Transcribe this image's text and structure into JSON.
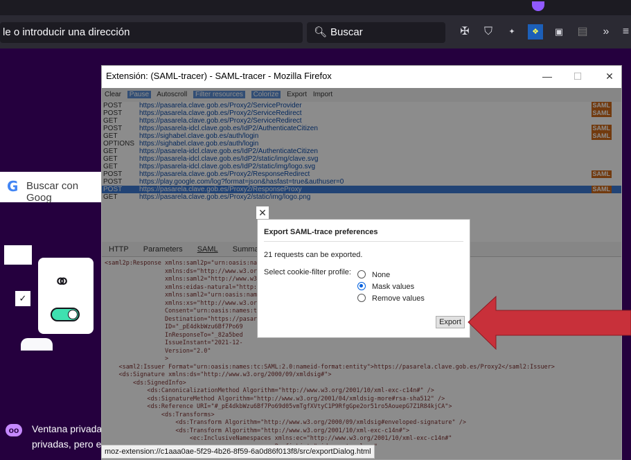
{
  "browser": {
    "urlbar_text": "le o introducir una dirección",
    "search_placeholder": "Buscar"
  },
  "private_page": {
    "google_search_text": "Buscar con Goog",
    "private_line1": "Ventana privada:",
    "private_line2": "privadas, pero es"
  },
  "window": {
    "title": "Extensión: (SAML-tracer) - SAML-tracer - Mozilla Firefox",
    "minimize": "—",
    "maximize": "☐",
    "close": "✕"
  },
  "tracer": {
    "toolbar": [
      "Clear",
      "Pause",
      "Autoscroll",
      "Filter resources",
      "Colorize",
      "Export",
      "Import"
    ],
    "requests": [
      {
        "method": "POST",
        "url": "https://pasarela.clave.gob.es/Proxy2/ServiceProvider",
        "badge": "SAML"
      },
      {
        "method": "POST",
        "url": "https://pasarela.clave.gob.es/Proxy2/ServiceRedirect",
        "badge": "SAML"
      },
      {
        "method": "GET",
        "url": "https://pasarela.clave.gob.es/Proxy2/ServiceRedirect",
        "badge": ""
      },
      {
        "method": "POST",
        "url": "https://pasarela-idcl.clave.gob.es/IdP2/AuthenticateCitizen",
        "badge": "SAML"
      },
      {
        "method": "GET",
        "url": "https://sighabel.clave.gob.es/auth/login",
        "badge": "SAML"
      },
      {
        "method": "OPTIONS",
        "url": "https://sighabel.clave.gob.es/auth/login",
        "badge": ""
      },
      {
        "method": "GET",
        "url": "https://pasarela-idcl.clave.gob.es/IdP2/AuthenticateCitizen",
        "badge": ""
      },
      {
        "method": "GET",
        "url": "https://pasarela-idcl.clave.gob.es/IdP2/static/img/clave.svg",
        "badge": ""
      },
      {
        "method": "GET",
        "url": "https://pasarela-idcl.clave.gob.es/IdP2/static/img/logo.svg",
        "badge": ""
      },
      {
        "method": "POST",
        "url": "https://pasarela.clave.gob.es/Proxy2/ResponseRedirect",
        "badge": "SAML"
      },
      {
        "method": "POST",
        "url": "https://play.google.com/log?format=json&hasfast=true&authuser=0",
        "badge": ""
      },
      {
        "method": "POST",
        "url": "https://pasarela.clave.gob.es/Proxy2/ResponseProxy",
        "badge": "SAML"
      },
      {
        "method": "GET",
        "url": "https://pasarela.clave.gob.es/Proxy2/static/img/logo.png",
        "badge": ""
      }
    ],
    "tabs": [
      "HTTP",
      "Parameters",
      "SAML",
      "Summary"
    ],
    "xml_lines": [
      "<saml2p:Response xmlns:saml2p=\"urn:oasis:names:tc:SAML:2.0:protocol\"",
      "                 xmlns:ds=\"http://www.w3.org/2000/09/xmldsig#\"",
      "                 xmlns:saml2=\"http://www.w3.org/2001/04/xmlenc#\"",
      "                 xmlns:eidas-natural=\"http://eidas.europa.eu/attributes/naturalperson\"",
      "                 xmlns:saml2=\"urn:oasis:names:tc:SAML:2.0:assertion\"",
      "                 xmlns:xs=\"http://www.w3.org/2001/XMLSchema\"",
      "                 Consent=\"urn:oasis:names:tc:SAML:2.0:consent:obtained\"",
      "                 Destination=\"https://pasarela.clave.gob.es/Proxy2/ResponseClave\"",
      "                 ID=\"_pE4dkbWzu6Bf7Po69",
      "                 InResponseTo=\"_82a5bed",
      "                 IssueInstant=\"2021-12-",
      "                 Version=\"2.0\"",
      "                 >",
      "    <saml2:Issuer Format=\"urn:oasis:names:tc:SAML:2.0:nameid-format:entity\">https://pasarela.clave.gob.es/Proxy2</saml2:Issuer>",
      "    <ds:Signature xmlns:ds=\"http://www.w3.org/2000/09/xmldsig#\">",
      "        <ds:SignedInfo>",
      "            <ds:CanonicalizationMethod Algorithm=\"http://www.w3.org/2001/10/xml-exc-c14n#\" />",
      "            <ds:SignatureMethod Algorithm=\"http://www.w3.org/2001/04/xmldsig-more#rsa-sha512\" />",
      "            <ds:Reference URI=\"#_pE4dkbWzu6Bf7Po69d05vmTgfXVtyC1P9RfgGpe2or51ro5AouepG7Z1R84kjCA\">",
      "                <ds:Transforms>",
      "                    <ds:Transform Algorithm=\"http://www.w3.org/2000/09/xmldsig#enveloped-signature\" />",
      "                    <ds:Transform Algorithm=\"http://www.w3.org/2001/10/xml-exc-c14n#\">",
      "                        <ec:InclusiveNamespaces xmlns:ec=\"http://www.w3.org/2001/10/xml-exc-c14n#\"",
      "                                                PrefixList=\"eidas-natural xs\""
    ]
  },
  "dialog": {
    "close": "✕",
    "title": "Export SAML-trace preferences",
    "count_text": "21 requests can be exported.",
    "profile_label": "Select cookie-filter profile:",
    "options": [
      "None",
      "Mask values",
      "Remove values"
    ],
    "selected": "Mask values",
    "export_label": "Export"
  },
  "status_url": "moz-extension://c1aaa0ae-5f29-4b26-8f59-6a0d86f013f8/src/exportDialog.html",
  "colors": {
    "arrow": "#c8303a",
    "private_bg": "#25003e",
    "accent": "#0060df"
  }
}
